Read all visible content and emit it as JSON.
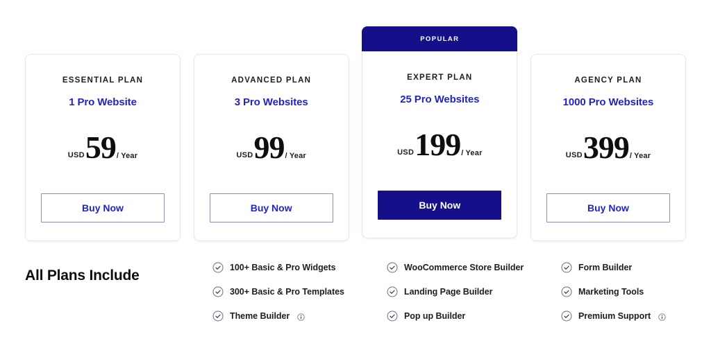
{
  "colors": {
    "brand_navy": "#15108a",
    "brand_blue": "#2322c4",
    "text_dark": "#1c1c23",
    "card_border": "#e8e8ea",
    "icon_gray": "#6b6b80",
    "background": "#ffffff"
  },
  "plans": [
    {
      "name": "ESSENTIAL PLAN",
      "sites": "1 Pro Website",
      "currency": "USD",
      "amount": "59",
      "period": "/ Year",
      "cta": "Buy Now",
      "popular": false,
      "badge": ""
    },
    {
      "name": "ADVANCED PLAN",
      "sites": "3 Pro Websites",
      "currency": "USD",
      "amount": "99",
      "period": "/ Year",
      "cta": "Buy Now",
      "popular": false,
      "badge": ""
    },
    {
      "name": "EXPERT PLAN",
      "sites": "25 Pro Websites",
      "currency": "USD",
      "amount": "199",
      "period": "/ Year",
      "cta": "Buy Now",
      "popular": true,
      "badge": "POPULAR"
    },
    {
      "name": "AGENCY PLAN",
      "sites": "1000 Pro Websites",
      "currency": "USD",
      "amount": "399",
      "period": "/ Year",
      "cta": "Buy Now",
      "popular": false,
      "badge": ""
    }
  ],
  "includes": {
    "title": "All Plans Include",
    "columns": [
      {
        "features": [
          {
            "label": "100+ Basic & Pro Widgets",
            "info": false
          },
          {
            "label": "300+ Basic & Pro Templates",
            "info": false
          },
          {
            "label": "Theme Builder",
            "info": true
          }
        ]
      },
      {
        "features": [
          {
            "label": "WooCommerce Store Builder",
            "info": false
          },
          {
            "label": "Landing Page Builder",
            "info": false
          },
          {
            "label": "Pop up Builder",
            "info": false
          }
        ]
      },
      {
        "features": [
          {
            "label": "Form Builder",
            "info": false
          },
          {
            "label": "Marketing Tools",
            "info": false
          },
          {
            "label": "Premium Support",
            "info": true
          }
        ]
      }
    ]
  },
  "icons": {
    "check": "check-circle-icon",
    "info": "info-circle-icon"
  }
}
